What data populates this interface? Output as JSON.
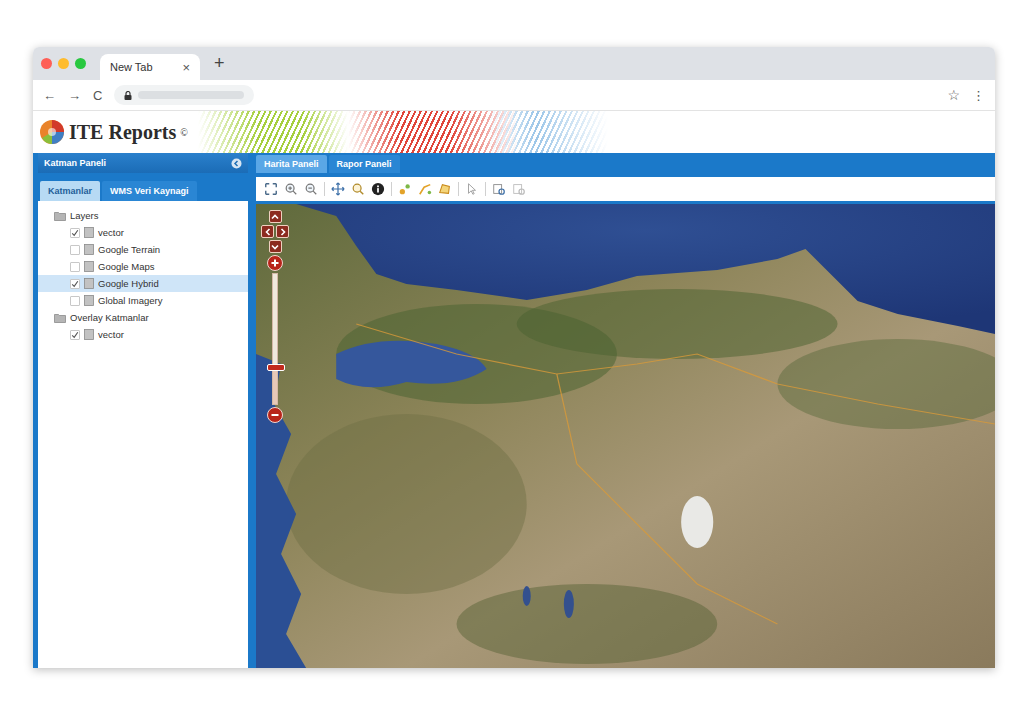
{
  "browser": {
    "tab": {
      "title": "New Tab",
      "close": "×",
      "selected": true
    },
    "new_tab": "+",
    "nav": [
      "←",
      "→",
      "C"
    ],
    "star": "☆",
    "menu": "⋮"
  },
  "app": {
    "logo": "ITE Reports",
    "logo_mark": "©"
  },
  "layer_panel": {
    "title": "Katman Paneli",
    "tabs": [
      {
        "label": "Katmanlar",
        "selected": true
      },
      {
        "label": "WMS Veri Kaynagi",
        "selected": false
      }
    ],
    "tree": [
      {
        "label": "Layers",
        "kind": "folder",
        "depth": 0,
        "selected": false
      },
      {
        "label": "vector",
        "kind": "layer",
        "depth": 1,
        "checked": true,
        "selected": false
      },
      {
        "label": "Google Terrain",
        "kind": "layer",
        "depth": 1,
        "checked": false,
        "selected": false
      },
      {
        "label": "Google Maps",
        "kind": "layer",
        "depth": 1,
        "checked": false,
        "selected": false
      },
      {
        "label": "Google Hybrid",
        "kind": "layer",
        "depth": 1,
        "checked": true,
        "selected": true
      },
      {
        "label": "Global Imagery",
        "kind": "layer",
        "depth": 1,
        "checked": false,
        "selected": false
      },
      {
        "label": "Overlay Katmanlar",
        "kind": "folder",
        "depth": 0,
        "selected": false
      },
      {
        "label": "vector",
        "kind": "layer",
        "depth": 1,
        "checked": true,
        "selected": false
      }
    ]
  },
  "map_panel": {
    "tabs": [
      {
        "label": "Harita Paneli",
        "selected": true
      },
      {
        "label": "Rapor Paneli",
        "selected": false
      }
    ],
    "zoom": {
      "level": 0.29
    }
  }
}
